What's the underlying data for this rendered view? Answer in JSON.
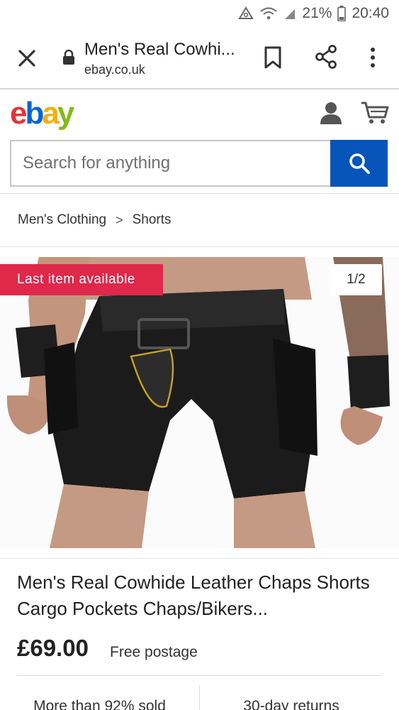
{
  "status_bar": {
    "battery": "21%",
    "time": "20:40"
  },
  "browser": {
    "page_title": "Men's Real Cowhi...",
    "domain": "ebay.co.uk"
  },
  "header": {
    "logo": {
      "e": "e",
      "b": "b",
      "a": "a",
      "y": "y"
    }
  },
  "search": {
    "placeholder": "Search for anything",
    "value": ""
  },
  "breadcrumb": {
    "items": [
      "Men's Clothing",
      "Shorts"
    ],
    "separator": ">"
  },
  "gallery": {
    "badge": "Last item available",
    "pager": "1/2"
  },
  "product": {
    "title": "Men's Real Cowhide Leather Chaps Shorts Cargo Pockets Chaps/Bikers...",
    "price": "£69.00",
    "postage": "Free postage"
  },
  "stats": {
    "sold": "More than 92% sold",
    "returns": "30-day returns"
  },
  "colors": {
    "brand_red": "#e53238",
    "brand_blue": "#0064d2",
    "brand_yellow": "#f5af02",
    "brand_green": "#86b817",
    "search_button": "#0654ba",
    "badge": "#e0284a"
  }
}
